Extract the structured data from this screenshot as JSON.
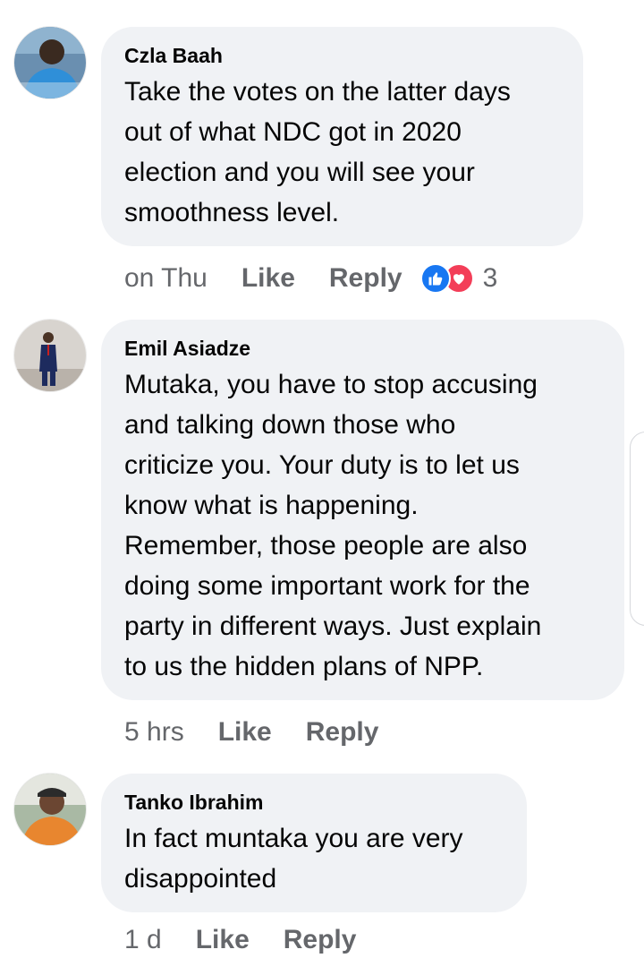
{
  "comments": [
    {
      "author": "Czla Baah",
      "text": "Take the votes on the latter days\nout of what NDC got in 2020\nelection and you will see your\nsmoothness level.",
      "time": "on Thu",
      "like_label": "Like",
      "reply_label": "Reply",
      "reaction_count": "3",
      "reaction_icons": [
        "like-icon",
        "love-icon"
      ]
    },
    {
      "author": "Emil Asiadze",
      "text": "Mutaka, you have to stop accusing\nand talking down those who\ncriticize you. Your duty is to let us\nknow what is happening.\nRemember, those people are also\ndoing some important work for the\nparty in different ways. Just explain\nto us the hidden plans of NPP.",
      "time": "5 hrs",
      "like_label": "Like",
      "reply_label": "Reply"
    },
    {
      "author": "Tanko Ibrahim",
      "text": "In fact muntaka you are very\ndisappointed",
      "time": "1 d",
      "like_label": "Like",
      "reply_label": "Reply"
    }
  ],
  "colors": {
    "bubble": "#f0f2f5",
    "text": "#050505",
    "meta": "#65676b",
    "like_blue": "#1877f2",
    "love_red": "#f33e58"
  }
}
